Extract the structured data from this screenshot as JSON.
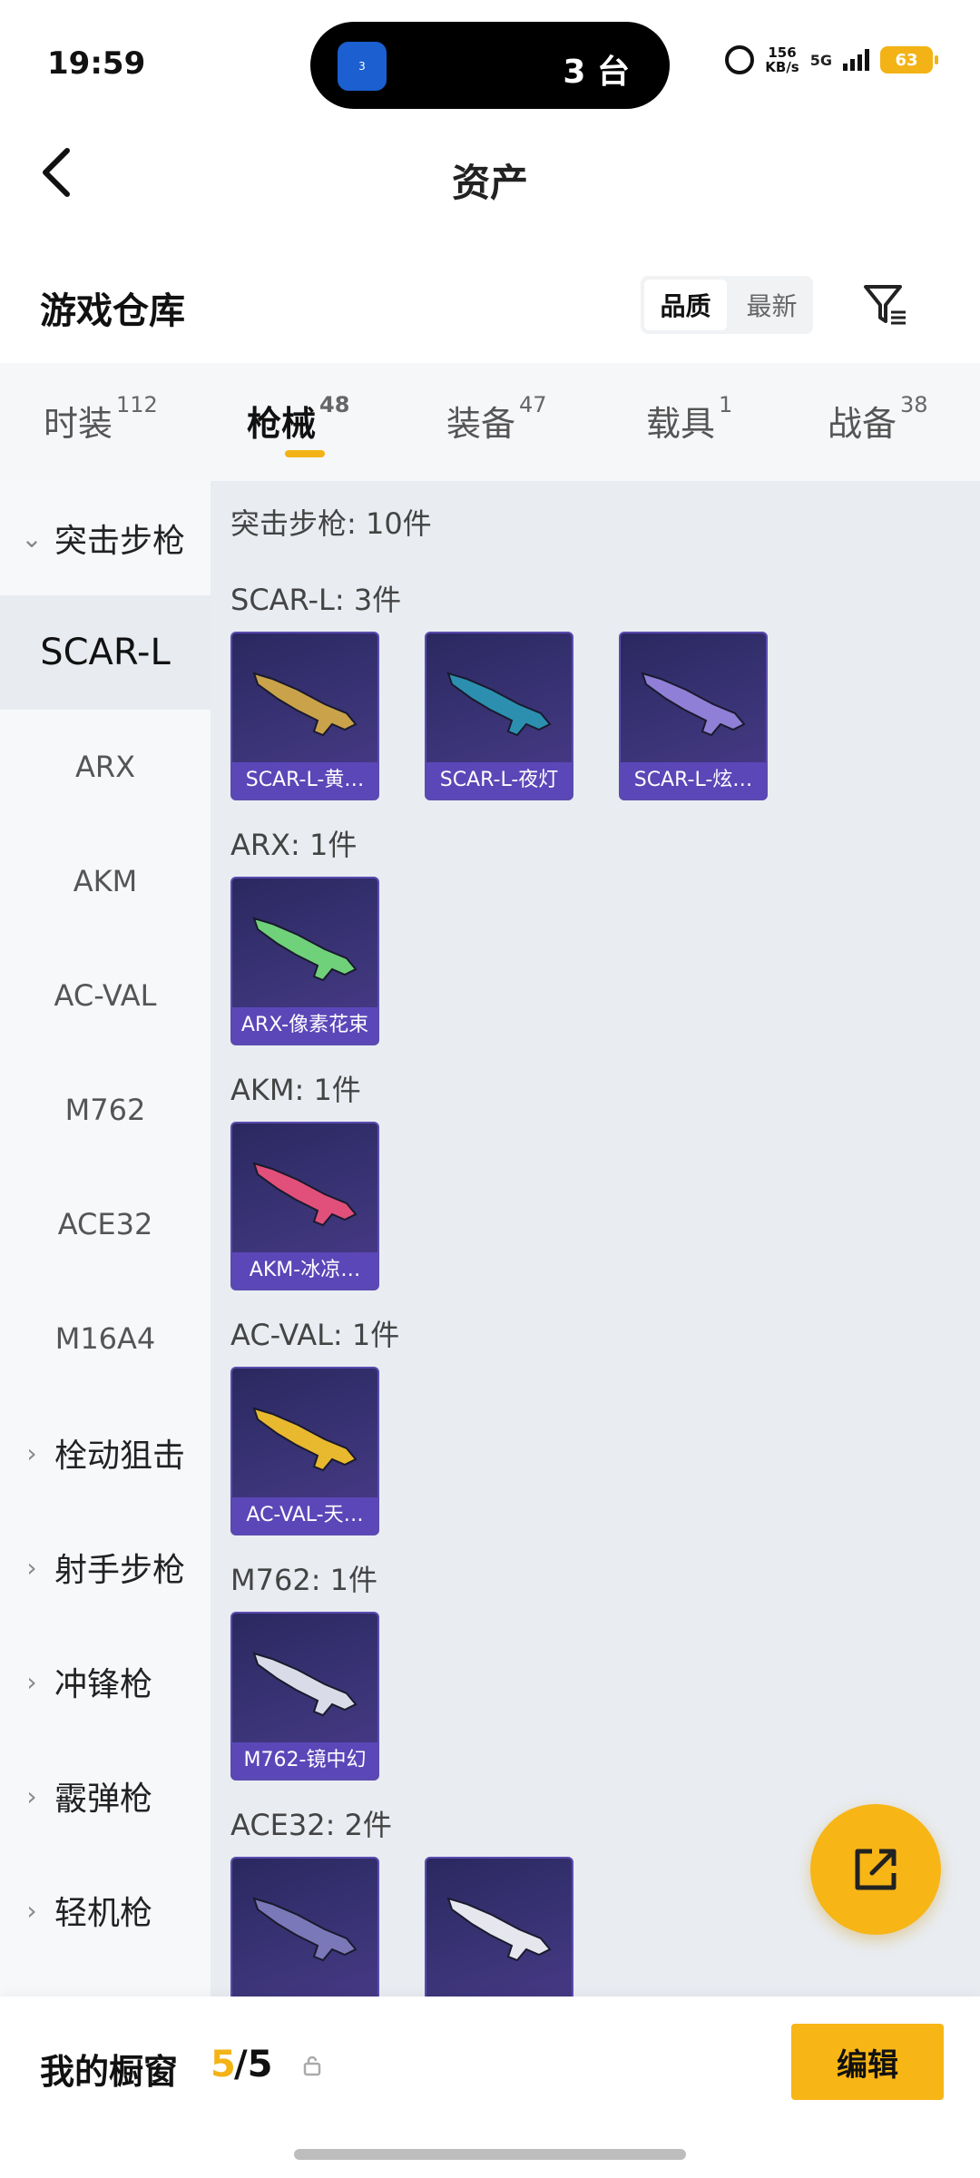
{
  "status_bar": {
    "time": "19:59",
    "island_badge": "3",
    "island_text": "3 台",
    "speed_value": "156",
    "speed_unit": "KB/s",
    "network": "5G",
    "battery": "63"
  },
  "header": {
    "title": "资产"
  },
  "section": {
    "title": "游戏仓库",
    "sort_options": [
      "品质",
      "最新"
    ],
    "sort_active": "品质"
  },
  "tabs": [
    {
      "label": "时装",
      "count": "112"
    },
    {
      "label": "枪械",
      "count": "48",
      "active": true
    },
    {
      "label": "装备",
      "count": "47"
    },
    {
      "label": "载具",
      "count": "1"
    },
    {
      "label": "战备",
      "count": "38"
    }
  ],
  "sidebar": {
    "items": [
      {
        "label": "突击步枪",
        "type": "group",
        "expanded": true
      },
      {
        "label": "SCAR-L",
        "type": "sub",
        "active": true
      },
      {
        "label": "ARX",
        "type": "sub"
      },
      {
        "label": "AKM",
        "type": "sub"
      },
      {
        "label": "AC-VAL",
        "type": "sub"
      },
      {
        "label": "M762",
        "type": "sub"
      },
      {
        "label": "ACE32",
        "type": "sub"
      },
      {
        "label": "M16A4",
        "type": "sub"
      },
      {
        "label": "栓动狙击",
        "type": "group"
      },
      {
        "label": "射手步枪",
        "type": "group"
      },
      {
        "label": "冲锋枪",
        "type": "group"
      },
      {
        "label": "霰弹枪",
        "type": "group"
      },
      {
        "label": "轻机枪",
        "type": "group"
      }
    ]
  },
  "content": {
    "summary": "突击步枪: 10件",
    "groups": [
      {
        "title": "SCAR-L: 3件",
        "cards": [
          {
            "label": "SCAR-L-黄…",
            "color": "#c9a24a"
          },
          {
            "label": "SCAR-L-夜灯",
            "color": "#2c8fb0"
          },
          {
            "label": "SCAR-L-炫…",
            "color": "#8f7fd6"
          }
        ]
      },
      {
        "title": "ARX: 1件",
        "cards": [
          {
            "label": "ARX-像素花束",
            "color": "#6fd17a"
          }
        ]
      },
      {
        "title": "AKM: 1件",
        "cards": [
          {
            "label": "AKM-冰凉…",
            "color": "#e0507a"
          }
        ]
      },
      {
        "title": "AC-VAL: 1件",
        "cards": [
          {
            "label": "AC-VAL-天…",
            "color": "#e8b82e"
          }
        ]
      },
      {
        "title": "M762: 1件",
        "cards": [
          {
            "label": "M762-镜中幻",
            "color": "#d9dce8"
          }
        ]
      },
      {
        "title": "ACE32: 2件",
        "cards": [
          {
            "label": "",
            "color": "#7a78b8"
          },
          {
            "label": "",
            "color": "#e6e6ee"
          }
        ]
      }
    ]
  },
  "bottom": {
    "label": "我的橱窗",
    "count_current": "5",
    "count_total": "/5",
    "edit_label": "编辑"
  },
  "colors": {
    "accent": "#f3b316",
    "card_bg": "#2a2860",
    "card_label_bg": "#5b47b8"
  }
}
